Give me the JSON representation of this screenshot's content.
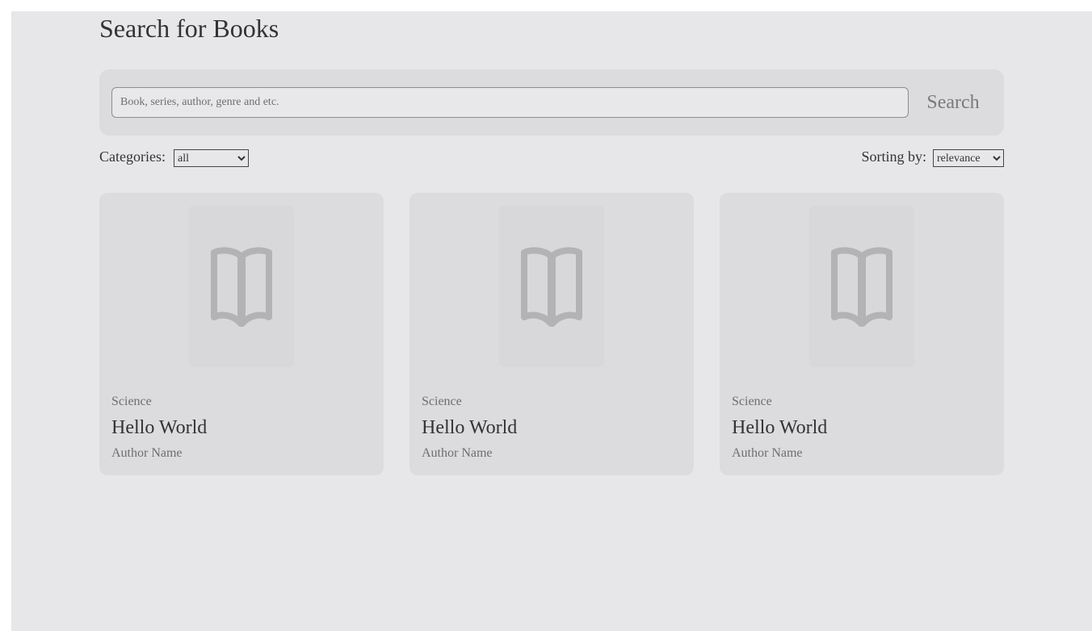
{
  "page": {
    "title": "Search for Books"
  },
  "search": {
    "placeholder": "Book, series, author, genre and etc.",
    "value": "",
    "button_label": "Search"
  },
  "filters": {
    "categories_label": "Categories:",
    "categories_selected": "all",
    "sorting_label": "Sorting by:",
    "sorting_selected": "relevance"
  },
  "books": [
    {
      "category": "Science",
      "title": "Hello World",
      "author": "Author Name",
      "cover_icon": "book-open-icon"
    },
    {
      "category": "Science",
      "title": "Hello World",
      "author": "Author Name",
      "cover_icon": "book-open-icon"
    },
    {
      "category": "Science",
      "title": "Hello World",
      "author": "Author Name",
      "cover_icon": "book-open-icon"
    }
  ],
  "colors": {
    "background": "#e7e7e9",
    "panel": "#dcdcde",
    "icon": "#b3b3b5",
    "text": "#333333",
    "muted_text": "#6e6e6e"
  }
}
